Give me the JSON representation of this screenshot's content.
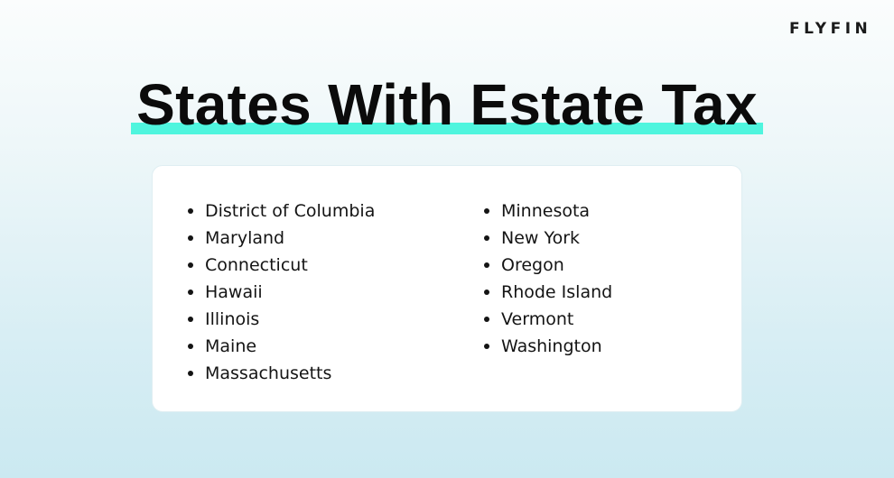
{
  "brand": {
    "logo_text": "FLYFIN"
  },
  "header": {
    "title": "States With Estate Tax",
    "highlight_color": "#4ff5de"
  },
  "states": {
    "left_column": [
      "District of Columbia",
      "Maryland",
      "Connecticut",
      "Hawaii",
      "Illinois",
      "Maine",
      "Massachusetts"
    ],
    "right_column": [
      "Minnesota",
      "New York",
      "Oregon",
      "Rhode Island",
      "Vermont",
      "Washington"
    ]
  }
}
